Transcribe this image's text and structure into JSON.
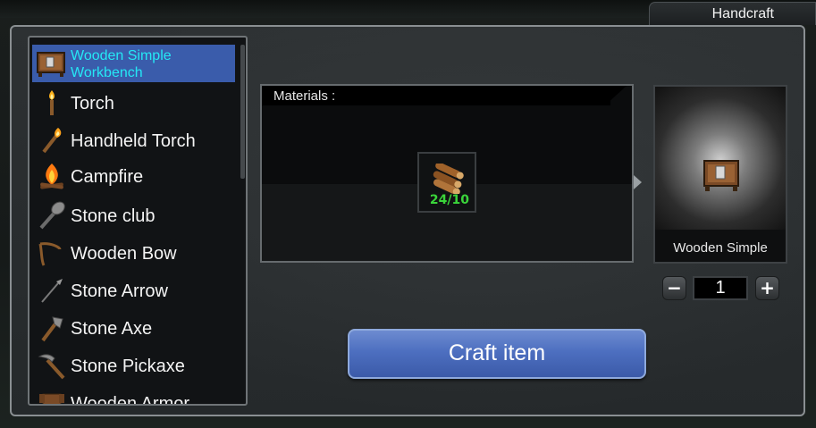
{
  "window": {
    "tab_title": "Handcraft"
  },
  "recipe_list": {
    "items": [
      {
        "label": "Wooden Simple Workbench",
        "icon": "workbench-icon",
        "selected": true
      },
      {
        "label": "Torch",
        "icon": "torch-icon",
        "selected": false
      },
      {
        "label": "Handheld Torch",
        "icon": "handheld-torch-icon",
        "selected": false
      },
      {
        "label": "Campfire",
        "icon": "campfire-icon",
        "selected": false
      },
      {
        "label": "Stone club",
        "icon": "stone-club-icon",
        "selected": false
      },
      {
        "label": "Wooden Bow",
        "icon": "bow-icon",
        "selected": false
      },
      {
        "label": "Stone Arrow",
        "icon": "arrow-icon",
        "selected": false
      },
      {
        "label": "Stone Axe",
        "icon": "axe-icon",
        "selected": false
      },
      {
        "label": "Stone Pickaxe",
        "icon": "pickaxe-icon",
        "selected": false
      },
      {
        "label": "Wooden Armor",
        "icon": "armor-icon",
        "selected": false
      }
    ]
  },
  "materials": {
    "title": "Materials :",
    "items": [
      {
        "icon": "wood-logs-icon",
        "count": "24/10"
      }
    ]
  },
  "preview": {
    "label": "Wooden Simple",
    "icon": "workbench-icon"
  },
  "quantity": {
    "value": "1",
    "minus": "−",
    "plus": "+"
  },
  "craft_button": {
    "label": "Craft item"
  },
  "colors": {
    "selected_row": "#3a5cab",
    "selected_text": "#25e8f5",
    "count_ok": "#3ad43a",
    "button": "#4d6fc0"
  }
}
